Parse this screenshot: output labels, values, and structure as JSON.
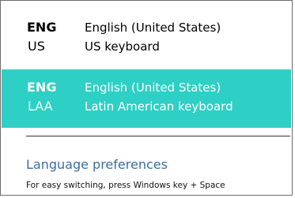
{
  "input_indicator": {
    "items": [
      {
        "code": "ENG",
        "sub_code": "US",
        "language": "English (United States)",
        "keyboard": "US keyboard",
        "selected": false
      },
      {
        "code": "ENG",
        "sub_code": "LAA",
        "language": "English (United States)",
        "keyboard": "Latin American keyboard",
        "selected": true
      }
    ],
    "preferences_link": "Language preferences",
    "hint": "For easy switching, press Windows key + Space"
  },
  "colors": {
    "selected_background": "#2ecfc4",
    "selected_text": "#ffffff",
    "text": "#000000",
    "link": "#3a6fa0",
    "border": "#6d6d6d"
  }
}
